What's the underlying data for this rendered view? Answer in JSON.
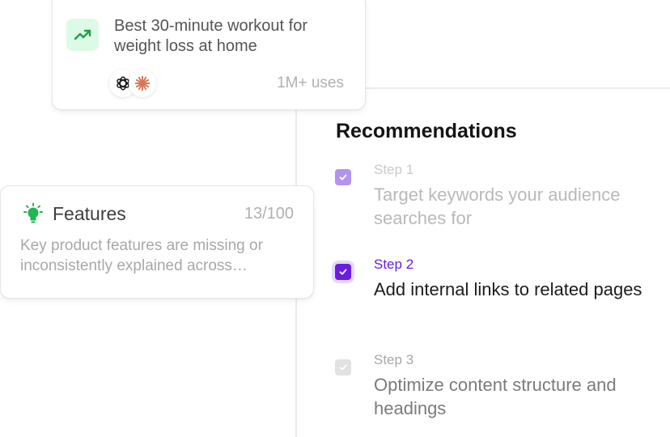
{
  "query_card": {
    "text": "Best 30-minute workout for weight loss at home",
    "uses": "1M+ uses",
    "trend_icon": "trending-up-icon",
    "ai_icons": [
      "openai-logo-icon",
      "claude-logo-icon"
    ],
    "colors": {
      "trend_bg": "#dcfbe6",
      "trend_fg": "#1f9d4c",
      "claude": "#d77757"
    }
  },
  "features_card": {
    "title": "Features",
    "score": "13/100",
    "description": "Key product features are missing or inconsistently explained across pages",
    "icon": "lightbulb-icon",
    "colors": {
      "icon": "#22b455"
    }
  },
  "recommendations": {
    "title": "Recommendations",
    "steps": [
      {
        "label": "Step 1",
        "text": "Target keywords your audience searches for",
        "state": "done"
      },
      {
        "label": "Step 2",
        "text": "Add internal links to related pages",
        "state": "active"
      },
      {
        "label": "Step 3",
        "text": "Optimize content structure and headings",
        "state": "pending"
      }
    ],
    "colors": {
      "accent": "#6a1de0",
      "done": "#b493ee",
      "pending": "#e2e2e2"
    }
  }
}
